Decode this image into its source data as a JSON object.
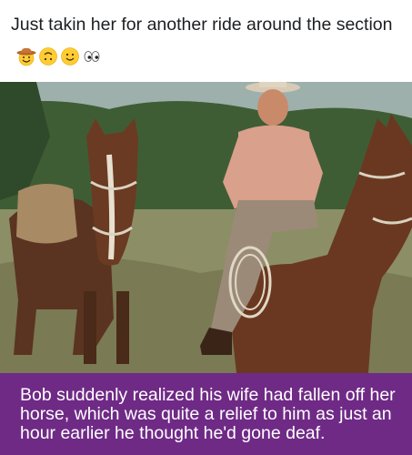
{
  "post": {
    "caption_text": "Just takin her for another ride around the section",
    "caption_emojis": [
      "cowboy-emoji",
      "upside-down-face-emoji",
      "slightly-smiling-face-emoji",
      "eyes-emoji"
    ]
  },
  "image": {
    "banner_text": "Bob suddenly realized his wife had fallen off her horse,  which was quite a relief to him as just an hour earlier he  thought he'd gone deaf.",
    "banner_color": "#6f2a86"
  }
}
